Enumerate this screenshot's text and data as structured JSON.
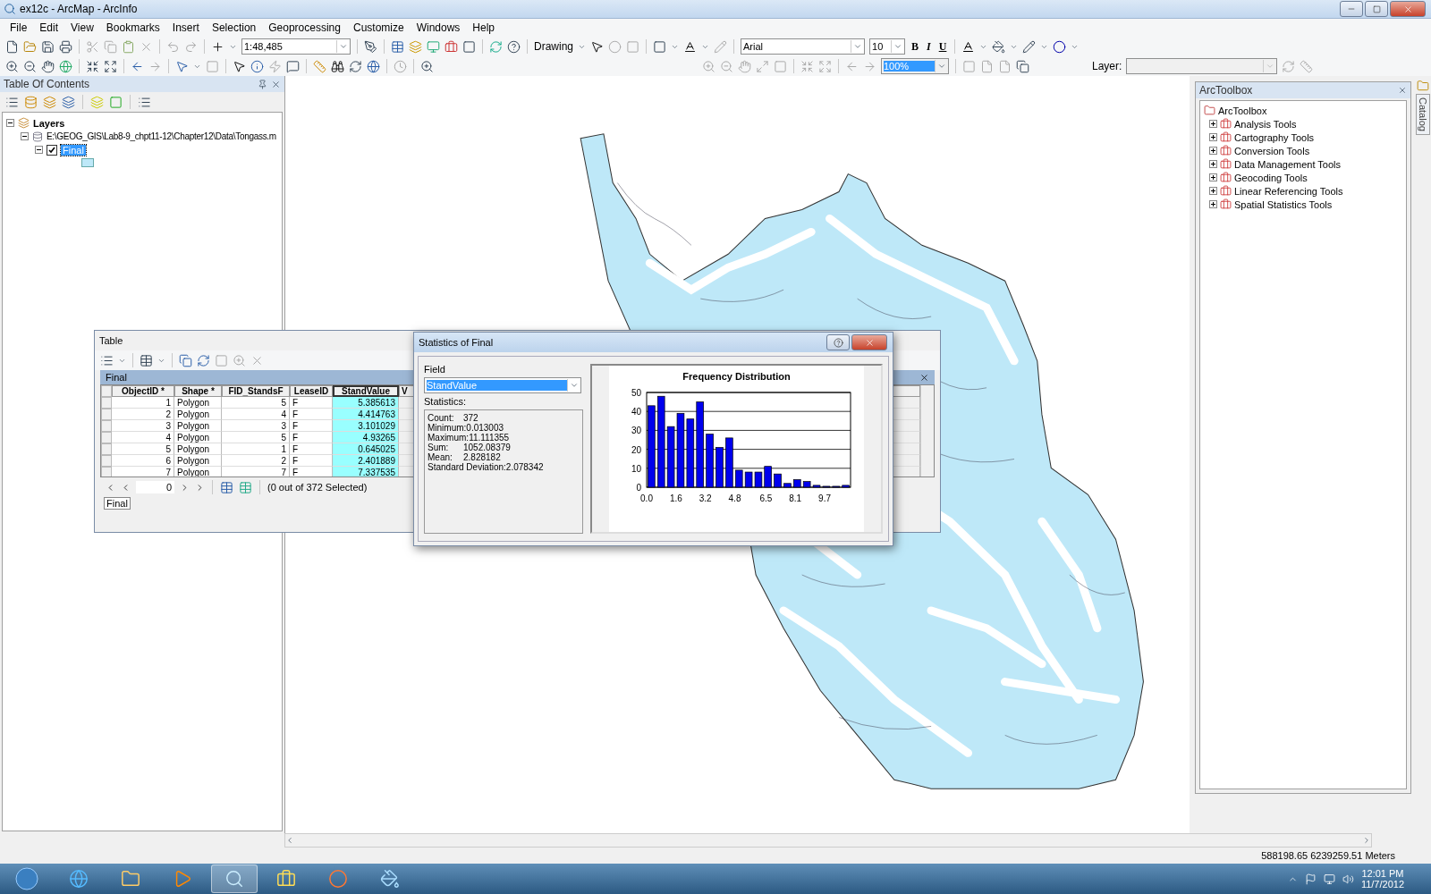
{
  "window": {
    "title": "ex12c - ArcMap - ArcInfo"
  },
  "menu": [
    "File",
    "Edit",
    "View",
    "Bookmarks",
    "Insert",
    "Selection",
    "Geoprocessing",
    "Customize",
    "Windows",
    "Help"
  ],
  "standard_toolbar": {
    "scale": "1:48,485"
  },
  "draw_toolbar": {
    "label": "Drawing",
    "font": "Arial",
    "font_size": "10",
    "bold": "B",
    "italic": "I",
    "underline": "U"
  },
  "layout_toolbar": {
    "zoom": "100%"
  },
  "georef_toolbar": {
    "label": "Layer:"
  },
  "toc": {
    "title": "Table Of Contents",
    "tree": [
      {
        "label": "Layers",
        "expanded": true,
        "children": [
          {
            "label": "E:\\GEOG_GIS\\Lab8-9_chpt11-12\\Chapter12\\Data\\Tongass.m",
            "expanded": true,
            "children": [
              {
                "label": "Final",
                "expanded": true,
                "checked": true,
                "selected": true
              }
            ]
          }
        ]
      }
    ]
  },
  "table": {
    "title": "Table",
    "layer": "Final",
    "columns": [
      {
        "label": "ObjectID *",
        "selected": false
      },
      {
        "label": "Shape *",
        "selected": false
      },
      {
        "label": "FID_StandsF",
        "selected": false
      },
      {
        "label": "LeaseID",
        "selected": false
      },
      {
        "label": "StandValue",
        "selected": true
      },
      {
        "label": "V",
        "selected": false
      }
    ],
    "rows": [
      [
        "1",
        "Polygon",
        "5",
        "F",
        "5.385613"
      ],
      [
        "2",
        "Polygon",
        "4",
        "F",
        "4.414763"
      ],
      [
        "3",
        "Polygon",
        "3",
        "F",
        "3.101029"
      ],
      [
        "4",
        "Polygon",
        "5",
        "F",
        "4.93265"
      ],
      [
        "5",
        "Polygon",
        "1",
        "F",
        "0.645025"
      ],
      [
        "6",
        "Polygon",
        "2",
        "F",
        "2.401889"
      ],
      [
        "7",
        "Polygon",
        "7",
        "F",
        "7.337535"
      ]
    ],
    "record": "0",
    "selection": "(0 out of 372 Selected)",
    "tab": "Final"
  },
  "statistics": {
    "title": "Statistics of Final",
    "field_label": "Field",
    "field": "StandValue",
    "stats_label": "Statistics:",
    "lines": [
      {
        "key": "Count:",
        "value": "372"
      },
      {
        "key": "Minimum:",
        "value": "0.013003"
      },
      {
        "key": "Maximum:",
        "value": "11.111355"
      },
      {
        "key": "Sum:",
        "value": "1052.08379"
      },
      {
        "key": "Mean:",
        "value": "2.828182"
      },
      {
        "key": "Standard Deviation:",
        "value": "2.078342"
      }
    ],
    "chart_data": {
      "type": "bar",
      "title": "Frequency Distribution",
      "x": [
        0.26,
        0.79,
        1.32,
        1.85,
        2.38,
        2.91,
        3.44,
        3.97,
        4.5,
        5.03,
        5.56,
        6.09,
        6.61,
        7.14,
        7.67,
        8.2,
        8.73,
        9.26,
        9.79,
        10.32,
        10.85
      ],
      "values": [
        43,
        48,
        32,
        39,
        36,
        45,
        28,
        21,
        26,
        9,
        8,
        8,
        11,
        7,
        2,
        4,
        3,
        1,
        0.5,
        0.5,
        1
      ],
      "xlim": [
        0,
        11.11
      ],
      "ylim": [
        0,
        50
      ],
      "grid": true,
      "xticks": [
        {
          "value": 0,
          "label": "0.0"
        },
        {
          "value": 1.6,
          "label": "1.6"
        },
        {
          "value": 3.2,
          "label": "3.2"
        },
        {
          "value": 4.8,
          "label": "4.8"
        },
        {
          "value": 6.5,
          "label": "6.5"
        },
        {
          "value": 8.1,
          "label": "8.1"
        },
        {
          "value": 9.7,
          "label": "9.7"
        }
      ],
      "yticks": [
        0,
        10,
        20,
        30,
        40,
        50
      ]
    }
  },
  "toolbox": {
    "title": "ArcToolbox",
    "root": "ArcToolbox",
    "items": [
      {
        "label": "Analysis Tools",
        "expanded": false
      },
      {
        "label": "Cartography Tools",
        "expanded": false
      },
      {
        "label": "Conversion Tools",
        "expanded": false
      },
      {
        "label": "Data Management Tools",
        "expanded": false
      },
      {
        "label": "Geocoding Tools",
        "expanded": false
      },
      {
        "label": "Linear Referencing Tools",
        "expanded": false
      },
      {
        "label": "Spatial Statistics Tools",
        "expanded": false
      }
    ]
  },
  "catalog_tab": "Catalog",
  "status_bar": "588198.65  6239259.51 Meters",
  "taskbar": {
    "time": "12:01 PM",
    "date": "11/7/2012"
  }
}
